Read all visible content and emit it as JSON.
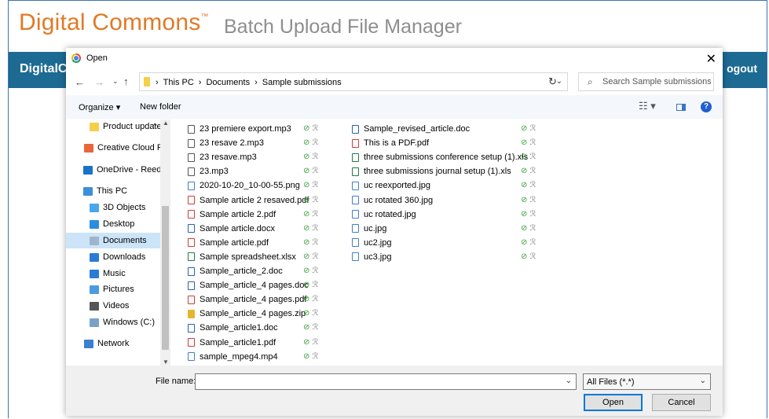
{
  "app": {
    "brand": "Digital Commons",
    "trademark": "™",
    "subtitle": "Batch Upload File Manager",
    "topbar_left": "DigitalC",
    "topbar_right": "ogout",
    "brand_color": "#e07a26",
    "bar_color": "#1d6a93"
  },
  "dialog": {
    "title": "Open",
    "close_glyph": "✕",
    "breadcrumbs": [
      "This PC",
      "Documents",
      "Sample submissions"
    ],
    "search_placeholder": "Search Sample submissions",
    "toolbar": {
      "organize": "Organize ▾",
      "new_folder": "New folder"
    },
    "nav_items": [
      {
        "label": "Product updates",
        "icon": "folder-icon",
        "color": "#f6cf4a",
        "selected": false
      },
      {
        "label": "Creative Cloud Fil",
        "icon": "creative-cloud-icon",
        "color": "#e8663a",
        "selected": false
      },
      {
        "label": "OneDrive - Reed E",
        "icon": "onedrive-icon",
        "color": "#1a73c9",
        "selected": false
      },
      {
        "label": "This PC",
        "icon": "computer-icon",
        "color": "#3c8fd9",
        "selected": false
      },
      {
        "label": "3D Objects",
        "icon": "3d-objects-icon",
        "color": "#48a8e8",
        "selected": false
      },
      {
        "label": "Desktop",
        "icon": "desktop-icon",
        "color": "#2c8de0",
        "selected": false
      },
      {
        "label": "Documents",
        "icon": "documents-icon",
        "color": "#9fb5cc",
        "selected": true
      },
      {
        "label": "Downloads",
        "icon": "downloads-icon",
        "color": "#2a7bd6",
        "selected": false
      },
      {
        "label": "Music",
        "icon": "music-icon",
        "color": "#2a7bd6",
        "selected": false
      },
      {
        "label": "Pictures",
        "icon": "pictures-icon",
        "color": "#4c9be0",
        "selected": false
      },
      {
        "label": "Videos",
        "icon": "videos-icon",
        "color": "#555555",
        "selected": false
      },
      {
        "label": "Windows (C:)",
        "icon": "drive-icon",
        "color": "#7aa2c8",
        "selected": false
      },
      {
        "label": "Network",
        "icon": "network-icon",
        "color": "#3a7fd0",
        "selected": false
      }
    ],
    "files_col1": [
      {
        "name": "23 premiere export.mp3",
        "type": "audio"
      },
      {
        "name": "23 resave 2.mp3",
        "type": "audio"
      },
      {
        "name": "23 resave.mp3",
        "type": "audio"
      },
      {
        "name": "23.mp3",
        "type": "audio"
      },
      {
        "name": "2020-10-20_10-00-55.png",
        "type": "image"
      },
      {
        "name": "Sample article 2 resaved.pdf",
        "type": "pdf"
      },
      {
        "name": "Sample article 2.pdf",
        "type": "pdf"
      },
      {
        "name": "Sample article.docx",
        "type": "word"
      },
      {
        "name": "Sample article.pdf",
        "type": "pdf"
      },
      {
        "name": "Sample spreadsheet.xlsx",
        "type": "excel"
      },
      {
        "name": "Sample_article_2.doc",
        "type": "word"
      },
      {
        "name": "Sample_article_4 pages.doc",
        "type": "word"
      },
      {
        "name": "Sample_article_4 pages.pdf",
        "type": "pdf"
      },
      {
        "name": "Sample_article_4 pages.zip",
        "type": "zip"
      },
      {
        "name": "Sample_article1.doc",
        "type": "word"
      },
      {
        "name": "Sample_article1.pdf",
        "type": "pdf"
      },
      {
        "name": "sample_mpeg4.mp4",
        "type": "video"
      }
    ],
    "files_col2": [
      {
        "name": "Sample_revised_article.doc",
        "type": "word"
      },
      {
        "name": "This is a PDF.pdf",
        "type": "pdf"
      },
      {
        "name": "three submissions conference setup (1).xls",
        "type": "excel"
      },
      {
        "name": "three submissions journal setup (1).xls",
        "type": "excel"
      },
      {
        "name": "uc reexported.jpg",
        "type": "image"
      },
      {
        "name": "uc rotated 360.jpg",
        "type": "image"
      },
      {
        "name": "uc rotated.jpg",
        "type": "image"
      },
      {
        "name": "uc.jpg",
        "type": "image"
      },
      {
        "name": "uc2.jpg",
        "type": "image"
      },
      {
        "name": "uc3.jpg",
        "type": "image"
      }
    ],
    "status_glyph": "⊘",
    "share_glyph": "ℛ",
    "footer": {
      "file_name_label": "File name:",
      "file_name_value": "",
      "filter_value": "All Files (*.*)",
      "open_label": "Open",
      "cancel_label": "Cancel"
    },
    "type_colors": {
      "audio": "#555555",
      "image": "#3f7fcf",
      "pdf": "#d23b3b",
      "word": "#2b5fb4",
      "excel": "#1e7b45",
      "zip": "#e6b530",
      "video": "#3f7fcf"
    }
  }
}
